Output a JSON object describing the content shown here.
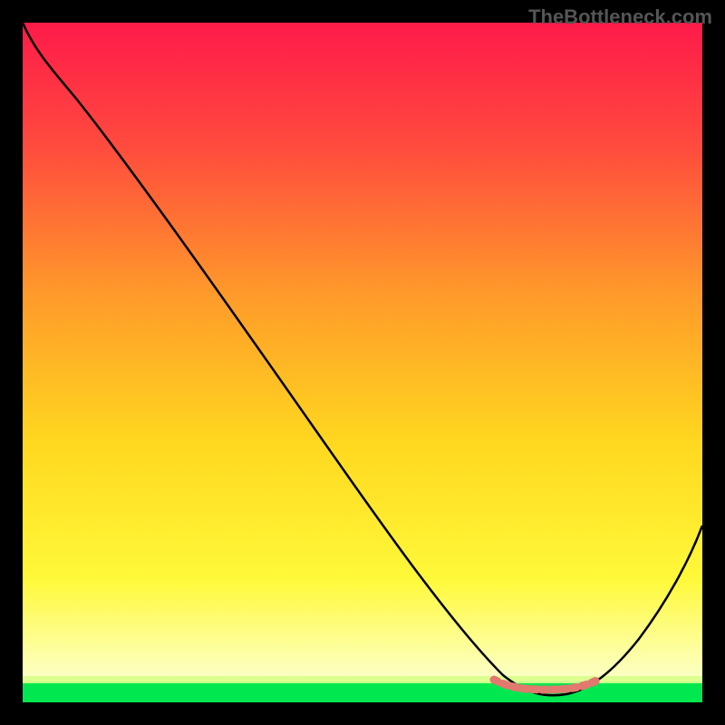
{
  "watermark": "TheBottleneck.com",
  "chart_data": {
    "type": "line",
    "title": "",
    "xlabel": "",
    "ylabel": "",
    "xlim": [
      0,
      100
    ],
    "ylim": [
      0,
      100
    ],
    "series": [
      {
        "name": "main-curve",
        "color": "#000000",
        "x": [
          0,
          5,
          10,
          15,
          20,
          25,
          30,
          35,
          40,
          45,
          50,
          55,
          60,
          65,
          70,
          75,
          80,
          85,
          90,
          95,
          100
        ],
        "y": [
          100,
          96,
          90,
          83,
          76,
          69,
          62,
          55,
          48,
          41,
          34,
          27,
          20,
          13,
          7,
          3,
          1,
          2,
          7,
          17,
          30
        ]
      },
      {
        "name": "bottom-band",
        "color": "#00ff56",
        "type": "area",
        "y_range": [
          0,
          3
        ]
      },
      {
        "name": "minimum-marker",
        "color": "#e2796f",
        "x": [
          70,
          72,
          74,
          76,
          78,
          80,
          82,
          84
        ],
        "y": [
          3,
          2.5,
          2.3,
          2.5,
          2.4,
          2.3,
          2.5,
          3
        ]
      }
    ],
    "gradient_background": {
      "top": "#ff1a4a",
      "mid": "#ffd000",
      "bottom": "#ffff60"
    }
  }
}
